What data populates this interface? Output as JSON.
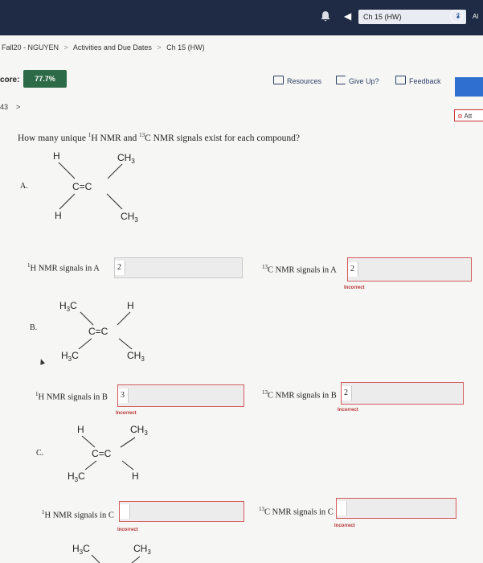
{
  "topbar": {
    "back_glyph": "◀",
    "chapter": "Ch 15 (HW)",
    "caret": "⬍",
    "help": "?",
    "all": "Al"
  },
  "breadcrumb": {
    "course": "Fall20 - NGUYEN",
    "sep1": ">",
    "activities": "Activities and Due Dates",
    "sep2": ">",
    "current": "Ch 15 (HW)"
  },
  "score": {
    "label": "core:",
    "value": "77.7%"
  },
  "toolbar": {
    "resources": "Resources",
    "give_up": "Give Up?",
    "feedback": "Feedback"
  },
  "question_nav": {
    "number": "43",
    "next": ">"
  },
  "attempt": {
    "label": "Att",
    "icon": "⊘"
  },
  "question": {
    "prefix": "How many unique ",
    "h": "H",
    "mid": " NMR and ",
    "c": "C",
    "suffix": " NMR signals exist for each compound?",
    "sup_h": "1",
    "sup_c": "13"
  },
  "molecules": {
    "A": {
      "letter": "A.",
      "ul": "H",
      "ur": "CH",
      "ur_sub": "3",
      "cc": "C=C",
      "ll": "H",
      "lr": "CH",
      "lr_sub": "3"
    },
    "B": {
      "letter": "B.",
      "ul": "H",
      "ul_sub": "3",
      "ul_c": "C",
      "ur": "H",
      "cc": "C=C",
      "ll": "H",
      "ll_sub": "3",
      "ll_c": "C",
      "lr": "CH",
      "lr_sub": "3"
    },
    "C": {
      "letter": "C.",
      "ul": "H",
      "ur": "CH",
      "ur_sub": "3",
      "cc": "C=C",
      "ll": "H",
      "ll_sub": "3",
      "ll_c": "C",
      "lr": "H"
    },
    "D": {
      "ul": "H",
      "ul_sub": "3",
      "ul_c": "C",
      "ur": "CH",
      "ur_sub": "3"
    }
  },
  "answers": {
    "h_prefix_sup": "1",
    "c_prefix_sup": "13",
    "A": {
      "h_label": "H NMR signals in A",
      "h_value": "2",
      "c_label": "C NMR signals in A",
      "c_value": "2",
      "c_feedback": "Incorrect"
    },
    "B": {
      "h_label": "H NMR signals in B",
      "h_value": "3",
      "h_feedback": "Incorrect",
      "c_label": "C NMR signals in B",
      "c_value": "2",
      "c_feedback": "Incorrect"
    },
    "C": {
      "h_label": "H NMR signals in C",
      "h_value": "",
      "h_feedback": "Incorrect",
      "c_label": "C NMR signals in C",
      "c_value": "",
      "c_feedback": "Incorrect"
    }
  }
}
